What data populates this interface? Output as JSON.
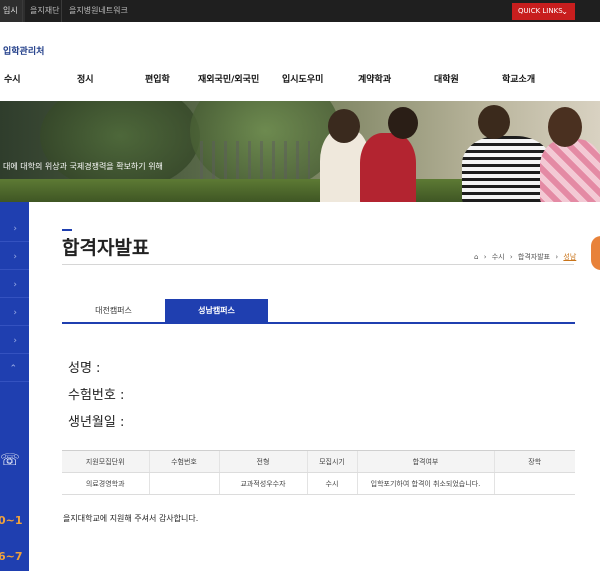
{
  "topbar": {
    "items": [
      "입시",
      "을지재단",
      "을지병원네트워크"
    ],
    "quick_links": "QUICK LINKS",
    "quick_chev": "⌄"
  },
  "header": {
    "brand": "입학관리처",
    "nav": [
      "수시",
      "정시",
      "편입학",
      "재외국민/외국민",
      "입시도우미",
      "계약학과",
      "대학원",
      "학교소개"
    ]
  },
  "banner": {
    "text": "대에 대학의 위상과 국제경쟁력을 확보하기 위해"
  },
  "sidenav": {
    "arrows": [
      "›",
      "›",
      "›",
      "›",
      "›",
      "⌃"
    ],
    "phone_icon": "☏",
    "numbers": [
      "0~1",
      "6~7"
    ]
  },
  "main": {
    "title": "합격자발표",
    "breadcrumb": {
      "home_icon": "⌂",
      "items": [
        "수시",
        "합격자발표",
        "성남"
      ],
      "separator": "›"
    },
    "tabs": [
      "대전캠퍼스",
      "성남캠퍼스"
    ],
    "info": {
      "name_label": "성명 :",
      "exam_label": "수험번호 :",
      "birth_label": "생년월일 :"
    },
    "table": {
      "headers": [
        "지원모집단위",
        "수험번호",
        "전형",
        "모집시기",
        "합격여부",
        "장학"
      ],
      "rows": [
        [
          "의료경영학과",
          "",
          "교과적성우수자",
          "수시",
          "입학포기하여 합격이 취소되었습니다.",
          ""
        ]
      ]
    },
    "thanks": "을지대학교에 지원해 주셔서 감사합니다."
  }
}
